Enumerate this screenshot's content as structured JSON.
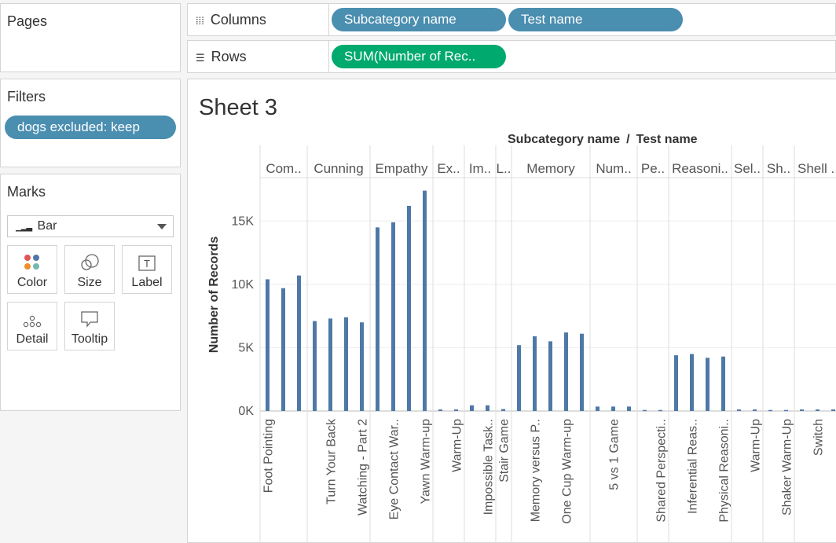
{
  "pages": {
    "title": "Pages"
  },
  "filters": {
    "title": "Filters",
    "items": [
      "dogs excluded: keep"
    ]
  },
  "marks": {
    "title": "Marks",
    "type": "Bar",
    "buttons": [
      "Color",
      "Size",
      "Label",
      "Detail",
      "Tooltip"
    ]
  },
  "shelves": {
    "columns": {
      "label": "Columns",
      "pills": [
        "Subcategory name",
        "Test name"
      ]
    },
    "rows": {
      "label": "Rows",
      "pills": [
        "SUM(Number of Rec.."
      ]
    }
  },
  "sheet": {
    "title": "Sheet 3"
  },
  "colors": {
    "bar": "#4e79a7",
    "pill_dimension": "#4a8eb0",
    "pill_measure": "#00a96e"
  },
  "chart_data": {
    "type": "bar",
    "header_title": "Subcategory name / Test name",
    "header_parts": [
      "Subcategory name",
      "/",
      "Test name"
    ],
    "ylabel": "Number of Records",
    "ylim": [
      0,
      17500
    ],
    "yticks": [
      0,
      5000,
      10000,
      15000
    ],
    "ytick_labels": [
      "0K",
      "5K",
      "10K",
      "15K"
    ],
    "groups": [
      {
        "label": "Com..",
        "bars": [
          {
            "label": "Foot Pointing",
            "value": 10400
          },
          {
            "label": "",
            "value": 9700
          },
          {
            "label": "",
            "value": 10700
          }
        ]
      },
      {
        "label": "Cunning",
        "bars": [
          {
            "label": "",
            "value": 7100
          },
          {
            "label": "Turn Your Back",
            "value": 7300
          },
          {
            "label": "",
            "value": 7400
          },
          {
            "label": "Watching - Part 2",
            "value": 7000
          }
        ]
      },
      {
        "label": "Empathy",
        "bars": [
          {
            "label": "",
            "value": 14500
          },
          {
            "label": "Eye Contact War..",
            "value": 14900
          },
          {
            "label": "",
            "value": 16200
          },
          {
            "label": "Yawn Warm-up",
            "value": 17400
          }
        ]
      },
      {
        "label": "Ex..",
        "bars": [
          {
            "label": "",
            "value": 120
          },
          {
            "label": "Warm-Up",
            "value": 120
          }
        ]
      },
      {
        "label": "Im..",
        "bars": [
          {
            "label": "",
            "value": 450
          },
          {
            "label": "Impossible Task..",
            "value": 450
          }
        ]
      },
      {
        "label": "L..",
        "bars": [
          {
            "label": "Stair Game",
            "value": 150
          }
        ]
      },
      {
        "label": "Memory",
        "bars": [
          {
            "label": "",
            "value": 5200
          },
          {
            "label": "Memory versus P..",
            "value": 5900
          },
          {
            "label": "",
            "value": 5500
          },
          {
            "label": "One Cup Warm-up",
            "value": 6200
          },
          {
            "label": "",
            "value": 6100
          }
        ]
      },
      {
        "label": "Num..",
        "bars": [
          {
            "label": "",
            "value": 350
          },
          {
            "label": "5 vs 1 Game",
            "value": 350
          },
          {
            "label": "",
            "value": 350
          }
        ]
      },
      {
        "label": "Pe..",
        "bars": [
          {
            "label": "",
            "value": 80
          },
          {
            "label": "Shared Perspecti..",
            "value": 80
          }
        ]
      },
      {
        "label": "Reasoni..",
        "bars": [
          {
            "label": "",
            "value": 4400
          },
          {
            "label": "Inferential Reas..",
            "value": 4500
          },
          {
            "label": "",
            "value": 4200
          },
          {
            "label": "Physical Reasoni..",
            "value": 4300
          }
        ]
      },
      {
        "label": "Sel..",
        "bars": [
          {
            "label": "",
            "value": 120
          },
          {
            "label": "Warm-Up",
            "value": 120
          }
        ]
      },
      {
        "label": "Sh..",
        "bars": [
          {
            "label": "",
            "value": 80
          },
          {
            "label": "Shaker Warm-Up",
            "value": 80
          }
        ]
      },
      {
        "label": "Shell ..",
        "bars": [
          {
            "label": "",
            "value": 120
          },
          {
            "label": "Switch",
            "value": 120
          },
          {
            "label": "",
            "value": 120
          }
        ]
      }
    ]
  }
}
